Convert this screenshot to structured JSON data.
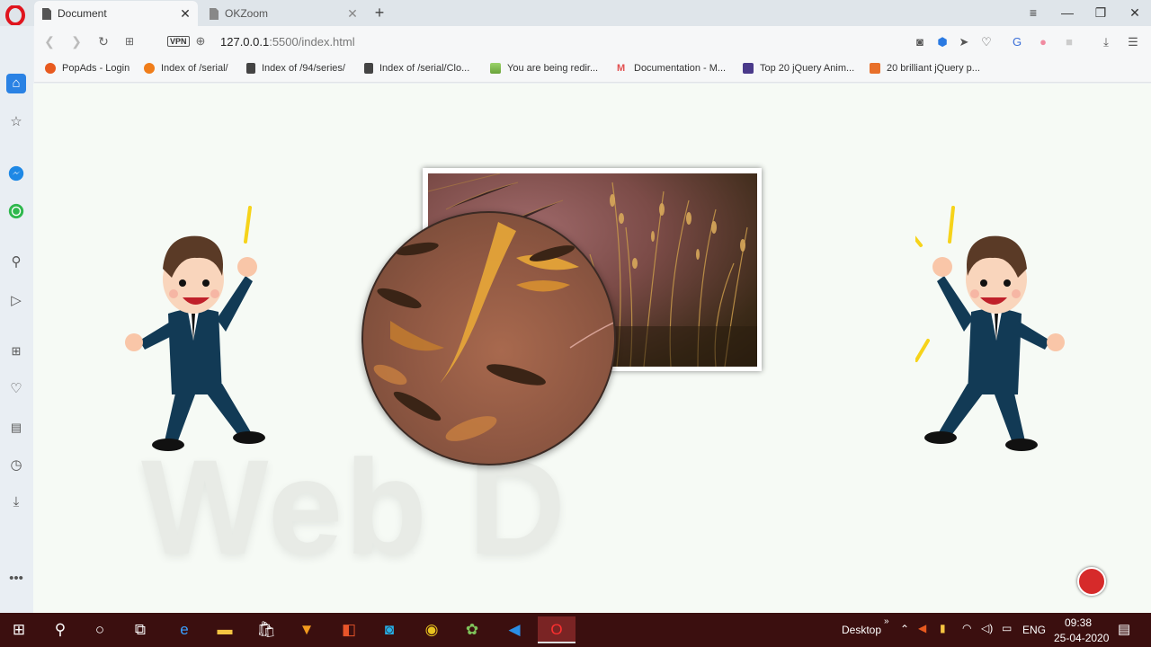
{
  "browser": {
    "tabs": [
      {
        "label": "Document",
        "active": true
      },
      {
        "label": "OKZoom",
        "active": false
      }
    ],
    "url_host": "127.0.0.1",
    "url_rest": ":5500/index.html",
    "vpn_label": "VPN",
    "bookmarks": [
      {
        "label": "PopAds - Login",
        "icon": "popads-icon",
        "color": "#e85a1f"
      },
      {
        "label": "Index of /serial/",
        "icon": "chart-icon",
        "color": "#f07d1a"
      },
      {
        "label": "Index of /94/series/",
        "icon": "document-icon",
        "color": "#444444"
      },
      {
        "label": "Index of /serial/Clo...",
        "icon": "document-icon",
        "color": "#444444"
      },
      {
        "label": "You are being redir...",
        "icon": "landscape-icon",
        "color": "#6aa33a"
      },
      {
        "label": "Documentation - M...",
        "icon": "m-icon",
        "color": "#e25050"
      },
      {
        "label": "Top 20 jQuery Anim...",
        "icon": "site-icon",
        "color": "#4a3a8a"
      },
      {
        "label": "20 brilliant jQuery p...",
        "icon": "site-icon",
        "color": "#e8702a"
      }
    ]
  },
  "page": {
    "watermark": "Web D"
  },
  "taskbar": {
    "desktop_label": "Desktop",
    "language": "ENG",
    "time": "09:38",
    "date": "25-04-2020"
  }
}
